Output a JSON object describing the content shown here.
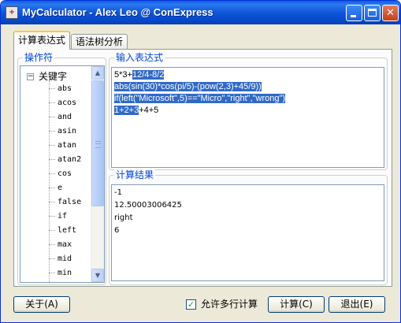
{
  "window": {
    "title": "MyCalculator - Alex Leo @ ConExpress",
    "app_icon_text": "+"
  },
  "tabs": [
    {
      "label": "计算表达式",
      "active": true
    },
    {
      "label": "语法树分析",
      "active": false
    }
  ],
  "operators": {
    "legend": "操作符",
    "root_label": "关键字",
    "root_expander": "−",
    "items": [
      "abs",
      "acos",
      "and",
      "asin",
      "atan",
      "atan2",
      "cos",
      "e",
      "false",
      "if",
      "left",
      "max",
      "mid",
      "min"
    ]
  },
  "input": {
    "legend": "输入表达式",
    "lines": [
      {
        "plain_before": "5*3+",
        "selected": "12/4-8/2",
        "plain_after": ""
      },
      {
        "plain_before": "",
        "selected": "abs(sin(30)*cos(pi/5)-(pow(2,3)+45/9))",
        "plain_after": ""
      },
      {
        "plain_before": "",
        "selected": "if(left(\"Microsoft\",5)==\"Micro\",\"right\",\"wrong\")",
        "plain_after": ""
      },
      {
        "plain_before": "",
        "selected": "1+2+3",
        "plain_after": "+4+5"
      }
    ]
  },
  "results": {
    "legend": "计算结果",
    "lines": [
      "-1",
      "12.50003006425",
      "right",
      "6"
    ]
  },
  "buttons": {
    "about": "关于(A)",
    "calculate": "计算(C)",
    "exit": "退出(E)"
  },
  "multiline": {
    "label": "允许多行计算",
    "checked": true,
    "check_glyph": "✓"
  },
  "scrollbar": {
    "up": "▲",
    "down": "▼"
  },
  "colors": {
    "title_bar": "#0a5fe0",
    "selection": "#316ac5",
    "legend_text": "#0046d5",
    "window_bg": "#ece9d8"
  }
}
